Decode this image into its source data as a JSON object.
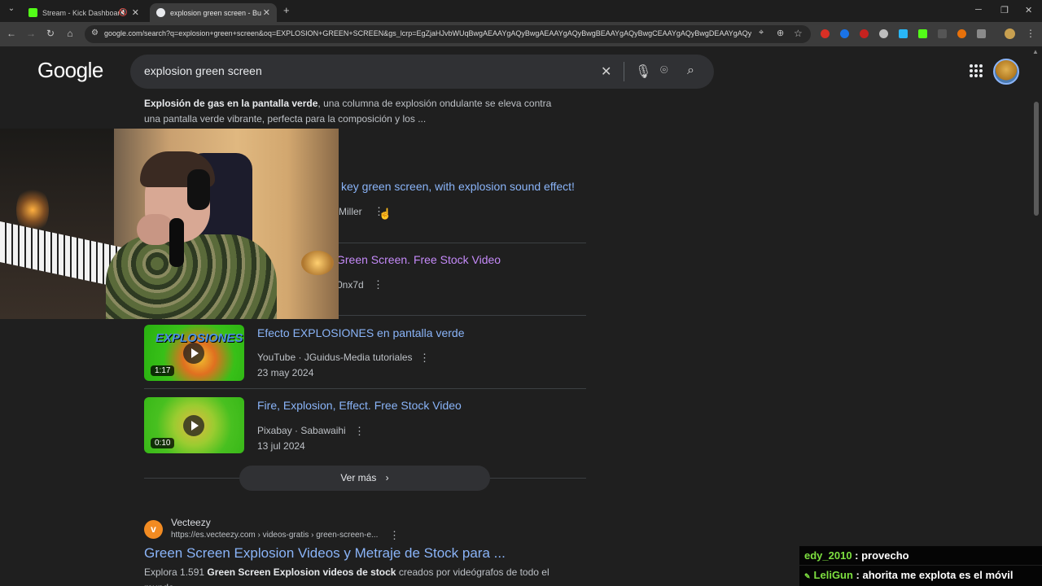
{
  "browser": {
    "tabs": [
      {
        "title": "Stream - Kick Dashboard",
        "favicon_color": "#53fc18"
      },
      {
        "title": "explosion green screen - Buscar",
        "favicon_color": "#e8eaed"
      }
    ],
    "url": "google.com/search?q=explosion+green+screen&oq=EXPLOSION+GREEN+SCREEN&gs_lcrp=EgZjaHJvbWUqBwgAEAAYgAQyBwgAEAAYgAQyBwgBEAAYgAQyBwgCEAAYgAQyBwgDEAAYgAQy..."
  },
  "google": {
    "logo": "Google",
    "query": "explosion green screen"
  },
  "snippet": {
    "bold": "Explosión de gas en la pantalla verde",
    "text": ", una columna de explosión ondulante se eleva contra una pantalla verde vibrante, perfecta para la composición y los ..."
  },
  "videos": [
    {
      "title": "key green screen, with explosion sound effect!",
      "meta": "Miller"
    },
    {
      "title": "Green Screen. Free Stock Video",
      "meta": "0nx7d"
    },
    {
      "title": "Efecto EXPLOSIONES en pantalla verde",
      "source": "YouTube · JGuidus-Media tutoriales",
      "date": "23 may 2024",
      "duration": "1:17",
      "thumb_text": "EXPLOSIONES"
    },
    {
      "title": "Fire, Explosion, Effect. Free Stock Video",
      "source": "Pixabay · Sabawaihi",
      "date": "13 jul 2024",
      "duration": "0:10"
    }
  ],
  "more_button": "Ver más",
  "result": {
    "site_name": "Vecteezy",
    "site_url": "https://es.vecteezy.com › videos-gratis › green-screen-e...",
    "title": "Green Screen Explosion Videos y Metraje de Stock para ...",
    "snippet_pre": "Explora 1.591 ",
    "snippet_bold": "Green Screen Explosion videos de stock",
    "snippet_post": " creados por videógrafos de todo el mundo"
  },
  "chat": [
    {
      "user": "edy_2010",
      "message": " : provecho"
    },
    {
      "user": "LeliGun",
      "message": " : ahorita me explota es el móvil"
    }
  ],
  "colors": {
    "link": "#8ab4f8",
    "visited": "#c58af9",
    "chat_user": "#7ee040"
  }
}
